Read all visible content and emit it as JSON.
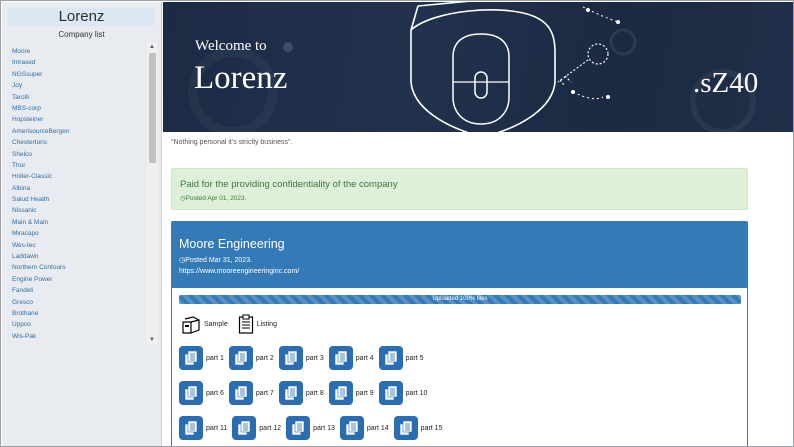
{
  "sidebar": {
    "brand": "Lorenz",
    "subtitle": "Company list",
    "companies": [
      "Moore",
      "Intrased",
      "NGSsuper",
      "Joy",
      "Tarolli",
      "MBS-corp",
      "Hopsteiner",
      "AmerisourceBergen",
      "Chestertons",
      "Shelco",
      "Thor",
      "Holler-Classic",
      "Albina",
      "Salud Health",
      "Nissanic",
      "Main & Main",
      "Miracapo",
      "Wes-tec",
      "Laddawn",
      "Northern Contours",
      "Engine Power",
      "Fandeli",
      "Gresco",
      "Brothane",
      "Uppco",
      "Wis-Pak"
    ]
  },
  "hero": {
    "welcome": "Welcome to",
    "name": "Lorenz",
    "code": ".sZ40"
  },
  "quote": "\"Nothing personal it's strictly business\".",
  "notice": {
    "title": "Paid for the providing confidentiality of the company",
    "posted": "Posted Apr 01, 2023."
  },
  "company": {
    "title": "Moore Engineering",
    "posted": "Posted Mar 31, 2023.",
    "url": "https://www.mooreengineeringinc.com/",
    "progress_label": "Uploaded 100% files",
    "progress": 100,
    "sample_label": "Sample",
    "listing_label": "Listing",
    "parts": [
      [
        "part 1",
        "part 2",
        "part 3",
        "part 4",
        "part 5"
      ],
      [
        "part 6",
        "part 7",
        "part 8",
        "part 9",
        "part 10"
      ],
      [
        "part 11",
        "part 12",
        "part 13",
        "part 14",
        "part 15"
      ]
    ]
  },
  "colors": {
    "accent": "#337ab7",
    "success_bg": "#dff0d8",
    "success_text": "#3c763d",
    "link": "#2f6ea8"
  }
}
